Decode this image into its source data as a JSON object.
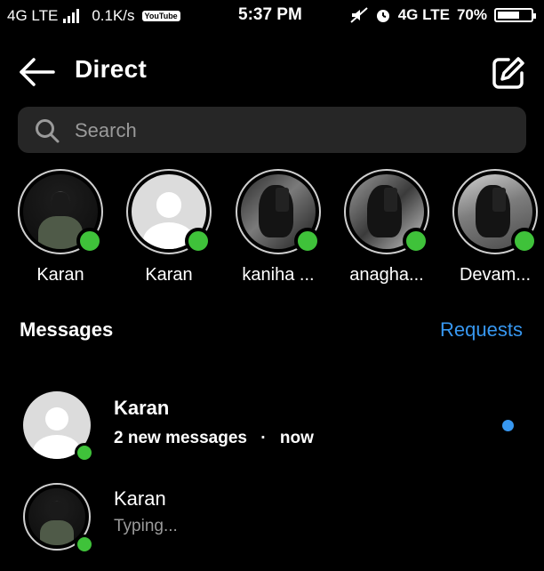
{
  "status_bar": {
    "network_left": "4G LTE",
    "speed": "0.1K/s",
    "youtube": "YouTube",
    "time": "5:37 PM",
    "network_right": "4G LTE",
    "battery": "70%",
    "battery_level": 0.7
  },
  "header": {
    "title": "Direct",
    "back_icon": "arrow-left-icon",
    "compose_icon": "compose-icon"
  },
  "search": {
    "placeholder": "Search",
    "value": ""
  },
  "stories": [
    {
      "label": "Karan",
      "avatar": "dark-photo",
      "online": true
    },
    {
      "label": "Karan",
      "avatar": "default",
      "online": true
    },
    {
      "label": "kaniha ...",
      "avatar": "photo",
      "online": true
    },
    {
      "label": "anagha...",
      "avatar": "photo",
      "online": true
    },
    {
      "label": "Devam...",
      "avatar": "photo",
      "online": true
    }
  ],
  "messages": {
    "heading": "Messages",
    "requests_label": "Requests"
  },
  "conversations": [
    {
      "name": "Karan",
      "preview": "2 new messages",
      "separator": "·",
      "time": "now",
      "unread": true,
      "avatar": "default",
      "online": true
    },
    {
      "name": "Karan",
      "preview": "Typing...",
      "unread": false,
      "avatar": "dark-photo",
      "online": true
    }
  ],
  "colors": {
    "background": "#000000",
    "online": "#3fc23a",
    "accent": "#3797f0",
    "search_bg": "#262626"
  }
}
